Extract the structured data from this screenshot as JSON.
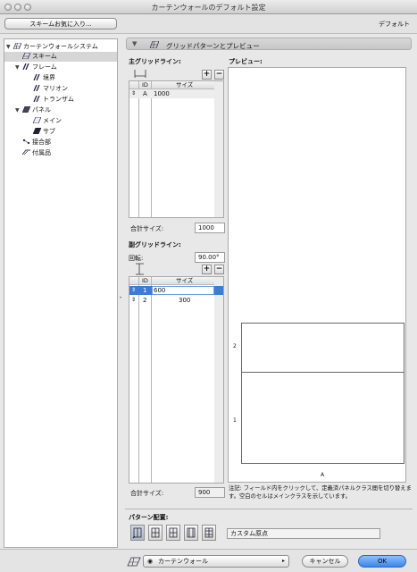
{
  "window": {
    "title": "カーテンウォールのデフォルト設定"
  },
  "toolbar": {
    "favorites_label": "スキームお気に入り...",
    "default_label": "デフォルト"
  },
  "tree": {
    "items": [
      {
        "label": "カーテンウォールシステム",
        "icon": "curtain-wall-icon",
        "expanded": true,
        "level": 0
      },
      {
        "label": "スキーム",
        "icon": "scheme-icon",
        "level": 1,
        "selected": true
      },
      {
        "label": "フレーム",
        "icon": "frame-icon",
        "expanded": true,
        "level": 1
      },
      {
        "label": "境界",
        "icon": "frame-icon",
        "level": 2
      },
      {
        "label": "マリオン",
        "icon": "frame-icon",
        "level": 2
      },
      {
        "label": "トランザム",
        "icon": "frame-icon",
        "level": 2
      },
      {
        "label": "パネル",
        "icon": "panel-icon",
        "expanded": true,
        "level": 1
      },
      {
        "label": "メイン",
        "icon": "panel-icon",
        "level": 2
      },
      {
        "label": "サブ",
        "icon": "panel-icon",
        "level": 2
      },
      {
        "label": "接合部",
        "icon": "junction-icon",
        "level": 1
      },
      {
        "label": "付属品",
        "icon": "accessory-icon",
        "level": 1
      }
    ]
  },
  "section": {
    "title": "グリッドパターンとプレビュー"
  },
  "main_grid": {
    "title": "主グリッドライン:",
    "columns": [
      "ID",
      "サイズ"
    ],
    "rows": [
      {
        "id": "A",
        "size": "1000"
      }
    ],
    "total_label": "合計サイズ:",
    "total_value": "1000"
  },
  "sub_grid": {
    "title": "副グリッドライン:",
    "rotation_label": "回転:",
    "rotation_value": "90.00°",
    "columns": [
      "ID",
      "サイズ"
    ],
    "rows": [
      {
        "id": "1",
        "size": "600",
        "selected": true
      },
      {
        "id": "2",
        "size": "300"
      }
    ],
    "total_label": "合計サイズ:",
    "total_value": "900"
  },
  "preview": {
    "title": "プレビュー:",
    "row_labels": [
      "2",
      "1"
    ],
    "col_label": "A",
    "note": "注記: フィールド内をクリックして、定義済パネルクラス間を切り替えます。空白のセルはメインクラスを示しています。"
  },
  "pattern": {
    "title": "パターン配置:",
    "origin_value": "カスタム原点"
  },
  "bottom": {
    "view_label": "カーテンウォール",
    "cancel_label": "キャンセル",
    "ok_label": "OK"
  },
  "colors": {
    "selection": "#3d7bd9",
    "ok_button": "#4f95f0"
  }
}
